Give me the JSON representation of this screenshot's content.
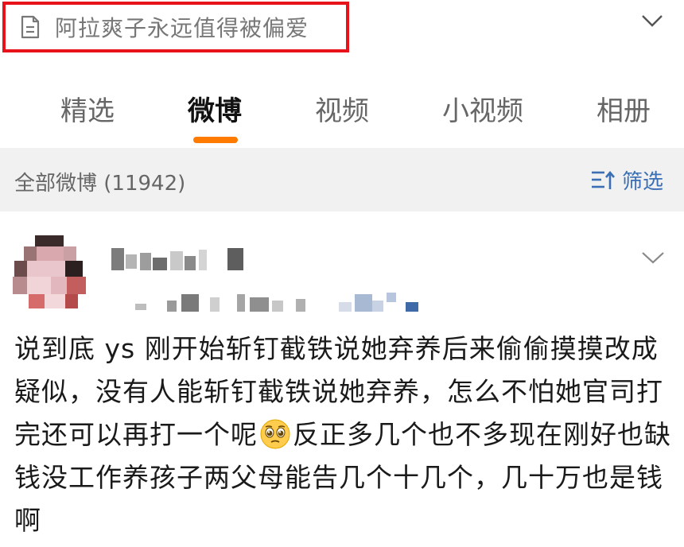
{
  "header": {
    "title": "阿拉爽子永远值得被偏爱",
    "doc_icon": "document-icon",
    "expand_icon": "chevron-down-icon"
  },
  "tabs": [
    {
      "label": "精选",
      "active": false
    },
    {
      "label": "微博",
      "active": true
    },
    {
      "label": "视频",
      "active": false
    },
    {
      "label": "小视频",
      "active": false
    },
    {
      "label": "相册",
      "active": false
    }
  ],
  "filter_bar": {
    "label": "全部微博 (11942)",
    "filter_button": "筛选",
    "filter_icon": "sort-filter-icon"
  },
  "post": {
    "avatar": "blurred-avatar",
    "username": "",
    "meta": "",
    "more_icon": "chevron-down-icon",
    "text_1": "说到底 ys 刚开始斩钉截铁说她弃养后来偷偷摸摸改成疑似，没有人能斩钉截铁说她弃养，怎么不怕她官司打完还可以再打一个呢",
    "emoji": "pleading-face-icon",
    "text_2": "反正多几个也不多现在刚好也缺钱没工作养孩子两父母能告几个十几个，几十万也是钱啊"
  },
  "colors": {
    "accent_orange": "#ff7a00",
    "highlight_red": "#e8121b",
    "link_blue": "#3a6fb5",
    "filter_bar_bg": "#f1f1f1"
  }
}
